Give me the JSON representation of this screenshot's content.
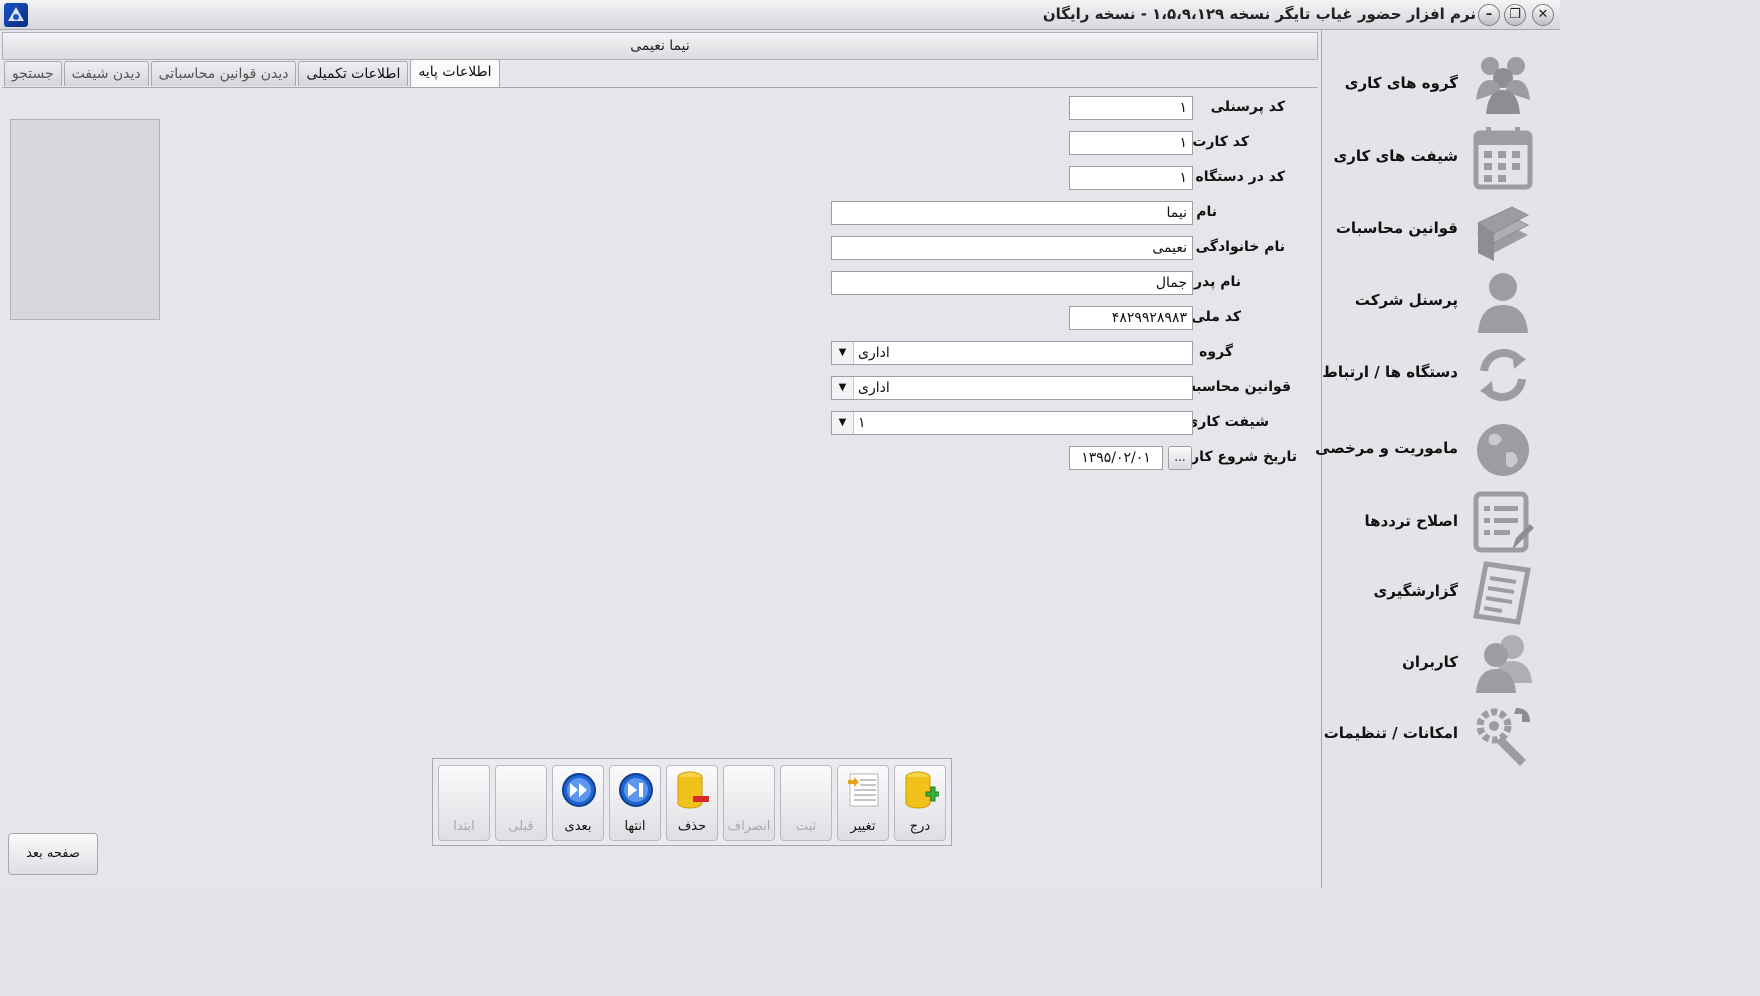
{
  "window": {
    "title": "نرم افزار حضور غیاب تایگر  نسخه ۱،۵،۹،۱۲۹ - نسخه رایگان",
    "app_icon": "app-logo-icon",
    "minimize": "–",
    "restore": "❐",
    "close": "✕"
  },
  "employee_header": "نیما نعیمی",
  "tabs": [
    {
      "label": "اطلاعات پایه",
      "active": true
    },
    {
      "label": "اطلاعات تکمیلی",
      "active": false
    },
    {
      "label": "دیدن قوانین محاسباتی",
      "active": false
    },
    {
      "label": "دیدن شیفت",
      "active": false
    },
    {
      "label": "جستجو",
      "active": false
    }
  ],
  "form": {
    "personnel_code": {
      "label": "کد پرسنلی",
      "value": "۱"
    },
    "card_code": {
      "label": "کد کارت",
      "value": "۱"
    },
    "device_code": {
      "label": "کد در دستگاه",
      "value": "۱"
    },
    "first_name": {
      "label": "نام",
      "value": "نیما"
    },
    "last_name": {
      "label": "نام خانوادگی",
      "value": "نعیمی"
    },
    "father_name": {
      "label": "نام پدر",
      "value": "جمال"
    },
    "national_code": {
      "label": "کد ملی",
      "value": "۴۸۲۹۹۲۸۹۸۳"
    },
    "group": {
      "label": "گروه",
      "value": "اداری"
    },
    "calc_rules": {
      "label": "قوانین محاسبه",
      "value": "اداری"
    },
    "work_shift": {
      "label": "شیفت کاری",
      "value": "۱"
    },
    "start_date": {
      "label": "تاریخ شروع کار",
      "value": "۱۳۹۵/۰۲/۰۱",
      "picker": "..."
    }
  },
  "toolbar": {
    "first": "ابتدا",
    "previous": "قبلی",
    "next": "بعدی",
    "last": "انتها",
    "delete": "حذف",
    "cancel": "انصراف",
    "save": "ثبت",
    "edit": "تغییر",
    "insert": "درج"
  },
  "next_page_button": "صفحه بعد",
  "sidebar": {
    "items": [
      {
        "label": "گروه های کاری",
        "icon": "people-group-icon"
      },
      {
        "label": "شیفت های کاری",
        "icon": "calendar-icon"
      },
      {
        "label": "قوانین محاسبات",
        "icon": "books-icon"
      },
      {
        "label": "پرسنل شرکت",
        "icon": "person-icon"
      },
      {
        "label": "دستگاه ها / ارتباط",
        "icon": "sync-icon"
      },
      {
        "label": "ماموریت و مرخصی",
        "icon": "globe-icon"
      },
      {
        "label": "اصلاح ترددها",
        "icon": "edit-list-icon"
      },
      {
        "label": "گزارشگیری",
        "icon": "report-icon"
      },
      {
        "label": "کاربران",
        "icon": "users-icon"
      },
      {
        "label": "امکانات / تنظیمات",
        "icon": "tools-icon"
      }
    ]
  },
  "colors": {
    "icon_gray": "#9c9ca2",
    "button_blue": "#1f64d0",
    "db_yellow": "#f1c21a"
  }
}
